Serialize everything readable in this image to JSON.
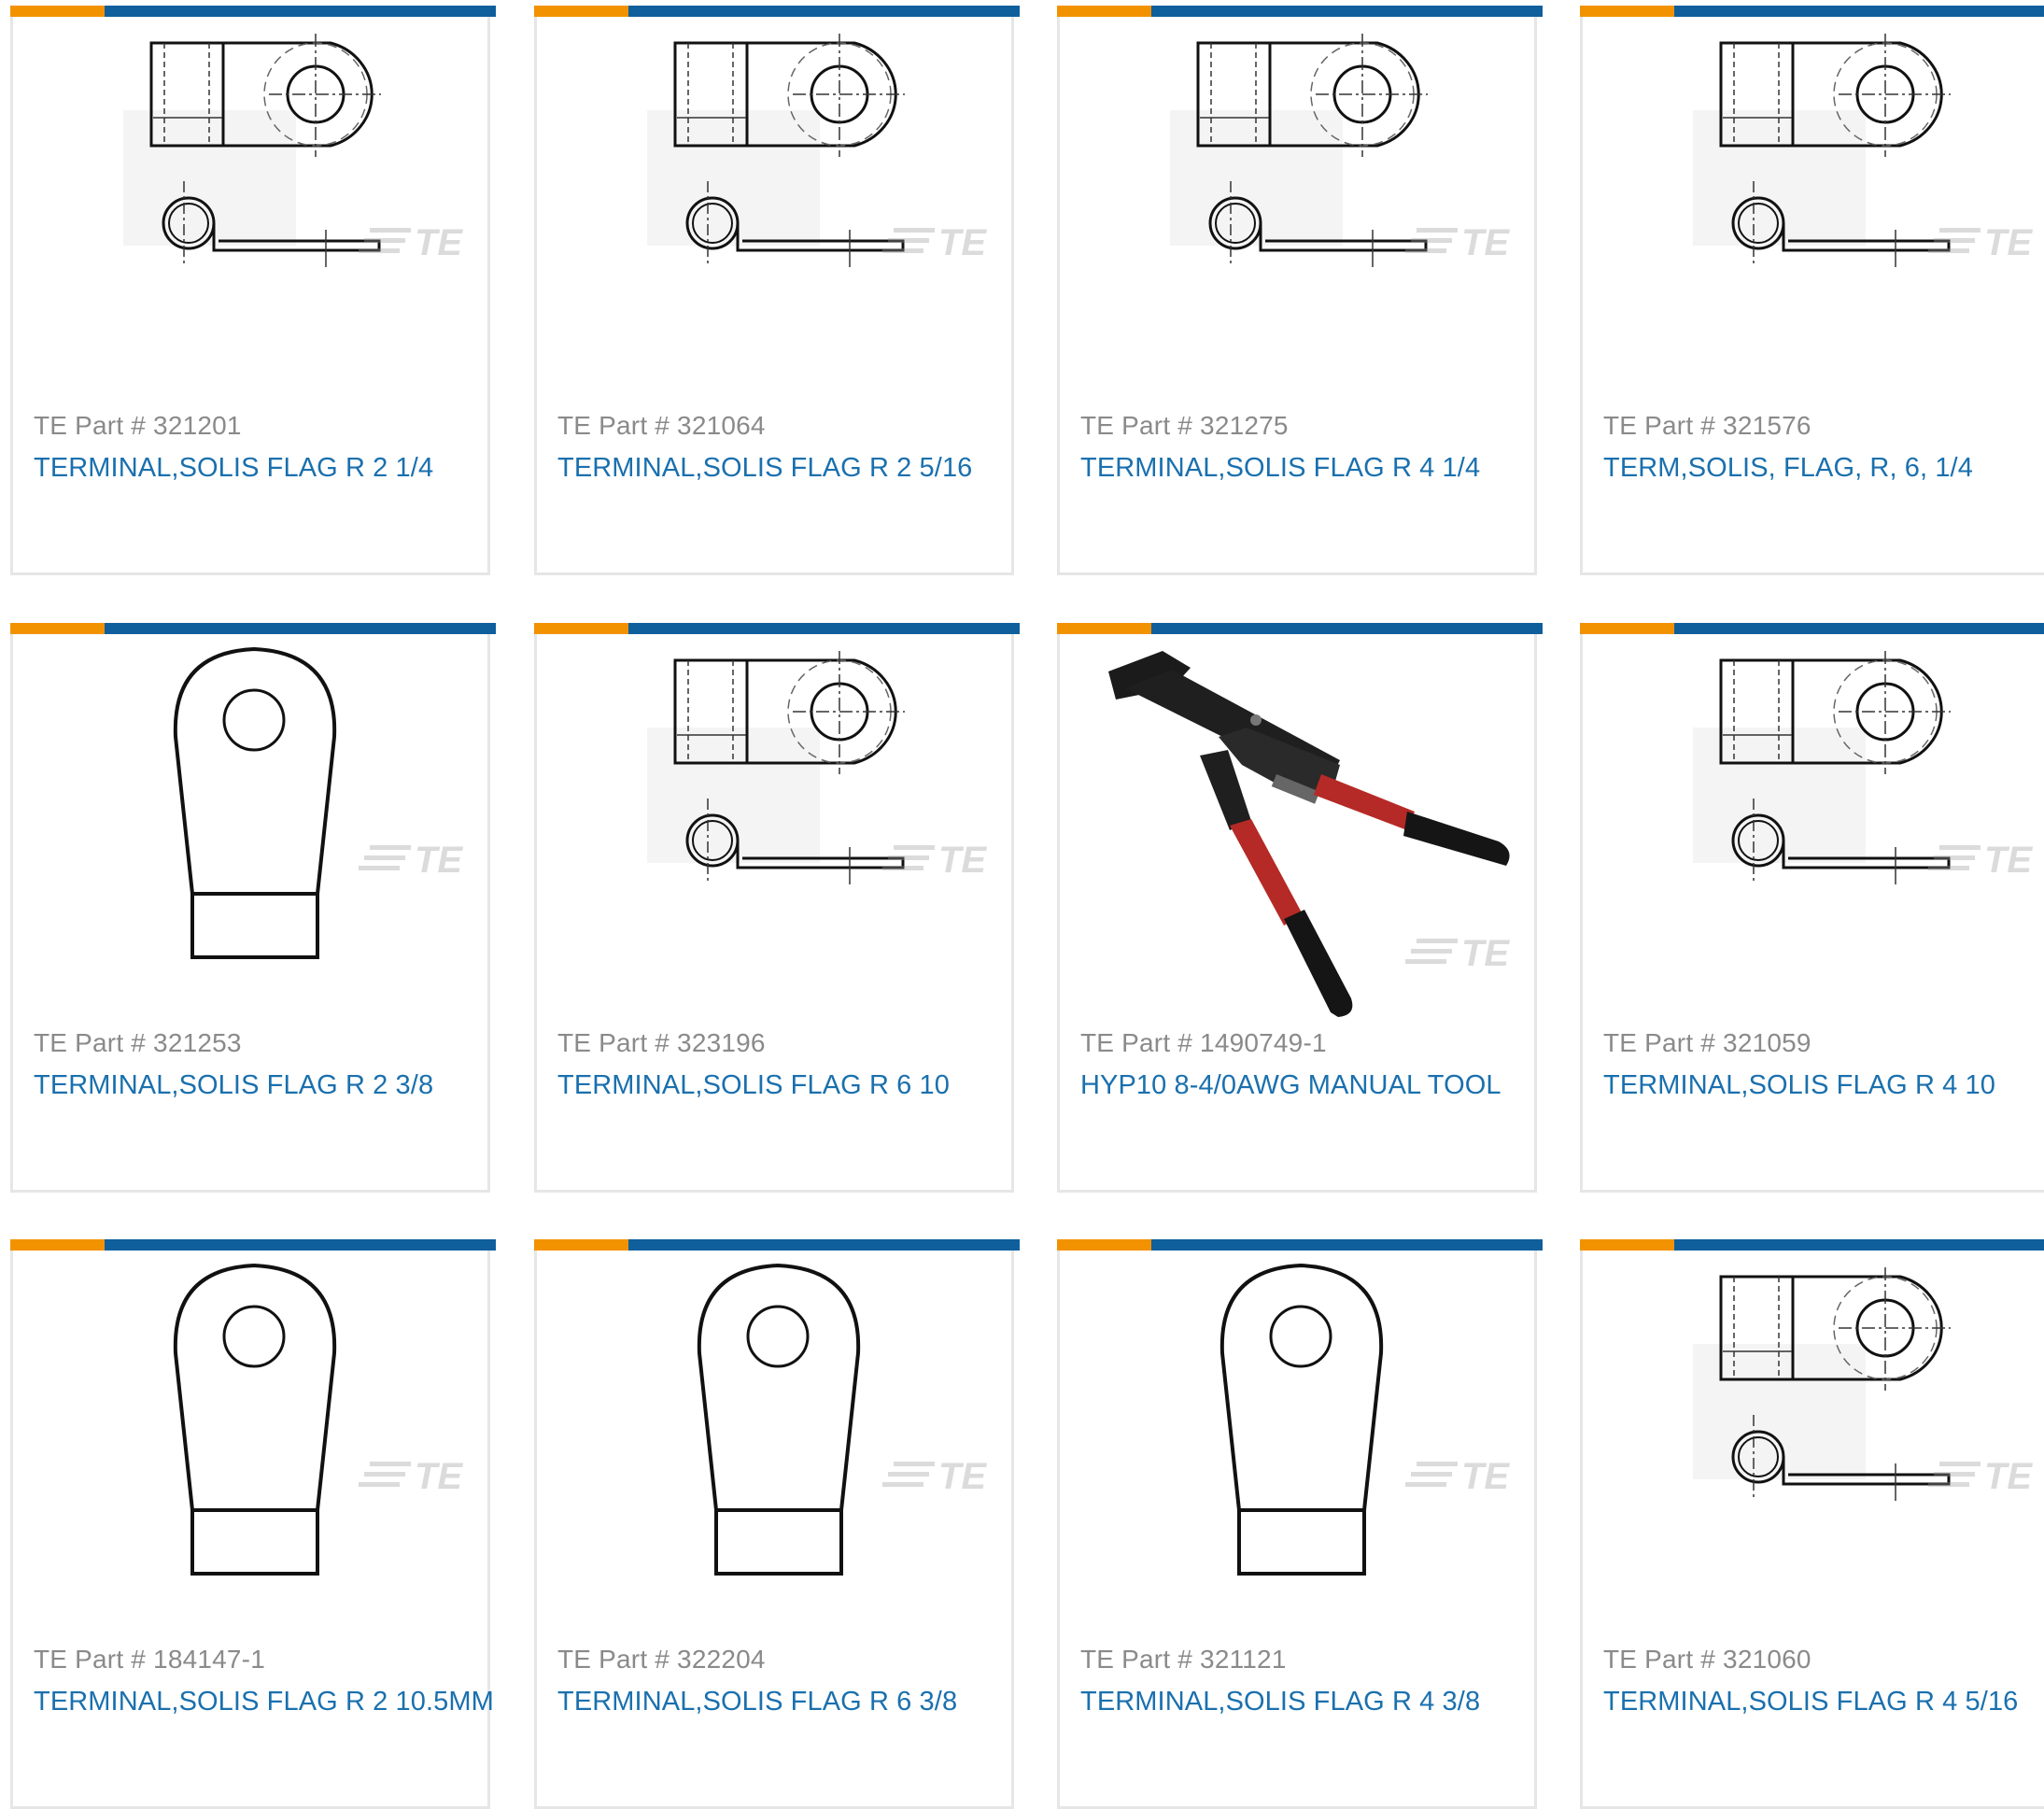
{
  "colors": {
    "accent_orange": "#f39200",
    "accent_blue": "#0f5f9c",
    "link_blue": "#1a70ae",
    "part_gray": "#8a8a8a"
  },
  "products": [
    {
      "part_prefix": "TE Part #",
      "part_number": "321201",
      "description": "TERMINAL,SOLIS FLAG R 2 1/4",
      "image": "flag-terminal-drawing"
    },
    {
      "part_prefix": "TE Part #",
      "part_number": "321064",
      "description": "TERMINAL,SOLIS FLAG R 2 5/16",
      "image": "flag-terminal-drawing"
    },
    {
      "part_prefix": "TE Part #",
      "part_number": "321275",
      "description": "TERMINAL,SOLIS FLAG R 4 1/4",
      "image": "flag-terminal-drawing"
    },
    {
      "part_prefix": "TE Part #",
      "part_number": "321576",
      "description": "TERM,SOLIS, FLAG, R, 6, 1/4",
      "image": "flag-terminal-drawing"
    },
    {
      "part_prefix": "TE Part #",
      "part_number": "321253",
      "description": "TERMINAL,SOLIS FLAG R 2 3/8",
      "image": "ring-tongue-drawing"
    },
    {
      "part_prefix": "TE Part #",
      "part_number": "323196",
      "description": "TERMINAL,SOLIS FLAG R 6 10",
      "image": "flag-terminal-drawing"
    },
    {
      "part_prefix": "TE Part #",
      "part_number": "1490749-1",
      "description": "HYP10 8-4/0AWG MANUAL TOOL",
      "image": "hydraulic-crimp-tool"
    },
    {
      "part_prefix": "TE Part #",
      "part_number": "321059",
      "description": "TERMINAL,SOLIS FLAG R 4 10",
      "image": "flag-terminal-drawing"
    },
    {
      "part_prefix": "TE Part #",
      "part_number": "184147-1",
      "description": "TERMINAL,SOLIS FLAG R 2 10.5MM",
      "image": "ring-tongue-drawing"
    },
    {
      "part_prefix": "TE Part #",
      "part_number": "322204",
      "description": "TERMINAL,SOLIS FLAG R 6 3/8",
      "image": "ring-tongue-drawing"
    },
    {
      "part_prefix": "TE Part #",
      "part_number": "321121",
      "description": "TERMINAL,SOLIS FLAG R 4 3/8",
      "image": "ring-tongue-drawing"
    },
    {
      "part_prefix": "TE Part #",
      "part_number": "321060",
      "description": "TERMINAL,SOLIS FLAG R 4 5/16",
      "image": "flag-terminal-drawing"
    }
  ],
  "watermark": "TE"
}
